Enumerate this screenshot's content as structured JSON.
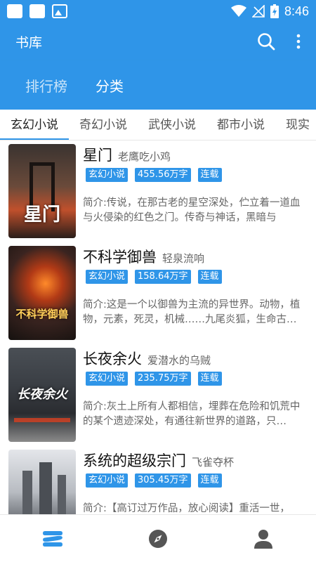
{
  "status_bar": {
    "time": "8:46"
  },
  "app_bar": {
    "title": "书库"
  },
  "top_tabs": [
    {
      "label": "排行榜",
      "active": false
    },
    {
      "label": "分类",
      "active": true
    }
  ],
  "category_tabs": [
    {
      "label": "玄幻小说",
      "active": true
    },
    {
      "label": "奇幻小说",
      "active": false
    },
    {
      "label": "武侠小说",
      "active": false
    },
    {
      "label": "都市小说",
      "active": false
    },
    {
      "label": "现实",
      "active": false
    }
  ],
  "books": [
    {
      "title": "星门",
      "author": "老鹰吃小鸡",
      "genre": "玄幻小说",
      "words": "455.56万字",
      "status": "连载",
      "intro": "简介:传说，在那古老的星空深处，伫立着一道血与火侵染的红色之门。传奇与神话，黑暗与",
      "cover_text": "星门"
    },
    {
      "title": "不科学御兽",
      "author": "轻泉流响",
      "genre": "玄幻小说",
      "words": "158.64万字",
      "status": "连载",
      "intro": "简介:这是一个以御兽为主流的异世界。动物，植物，元素，死灵，机械……九尾炎狐，生命古…",
      "cover_text": "不科学御兽"
    },
    {
      "title": "长夜余火",
      "author": "爱潜水的乌贼",
      "genre": "玄幻小说",
      "words": "235.75万字",
      "status": "连载",
      "intro": "简介:灰土上所有人都相信，埋葬在危险和饥荒中的某个遗迹深处，有通往新世界的道路，只…",
      "cover_text": "长夜余火"
    },
    {
      "title": "系统的超级宗门",
      "author": "飞雀夺杯",
      "genre": "玄幻小说",
      "words": "305.45万字",
      "status": "连载",
      "intro": "简介:【高订过万作品，放心阅读】重活一世，",
      "cover_text": ""
    }
  ],
  "bottom_nav": [
    {
      "icon": "bookshelf-icon",
      "active": true
    },
    {
      "icon": "compass-icon",
      "active": false
    },
    {
      "icon": "person-icon",
      "active": false
    }
  ],
  "colors": {
    "primary": "#2f95e8",
    "tag_bg": "#2f95e8",
    "nav_inactive": "#555555"
  }
}
